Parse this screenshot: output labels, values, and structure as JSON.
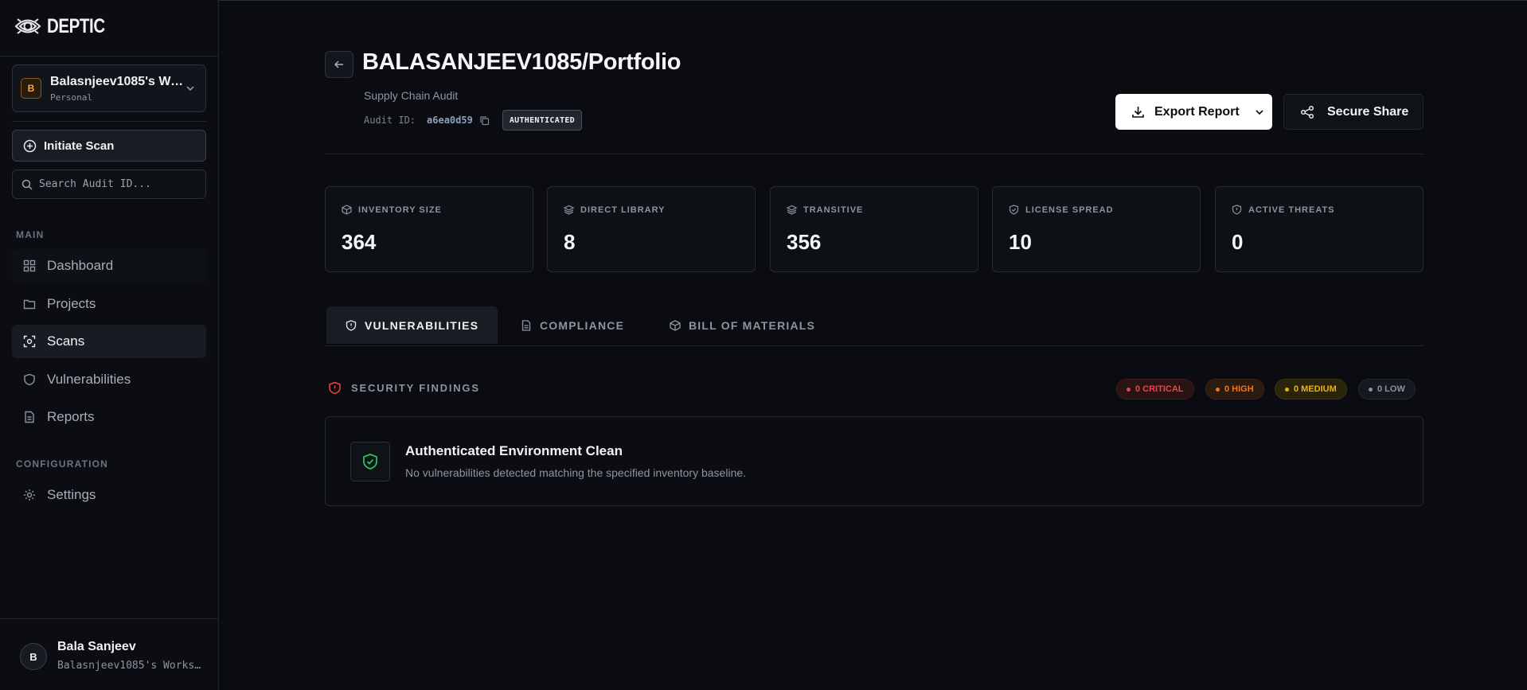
{
  "brand": {
    "name": "DEPTIC"
  },
  "workspace": {
    "initial": "B",
    "name": "Balasnjeev1085's Workspace",
    "type": "Personal"
  },
  "actions": {
    "initiate_scan": "Initiate Scan",
    "search_placeholder": "Search Audit ID..."
  },
  "sidebar": {
    "main_label": "MAIN",
    "items": [
      {
        "label": "Dashboard",
        "icon": "grid-icon"
      },
      {
        "label": "Projects",
        "icon": "folder-icon"
      },
      {
        "label": "Scans",
        "icon": "scan-icon",
        "active": true
      },
      {
        "label": "Vulnerabilities",
        "icon": "shield-icon"
      },
      {
        "label": "Reports",
        "icon": "document-icon"
      }
    ],
    "config_label": "CONFIGURATION",
    "config_items": [
      {
        "label": "Settings",
        "icon": "gear-icon"
      }
    ]
  },
  "user": {
    "initial": "B",
    "name": "Bala Sanjeev",
    "workspace": "Balasnjeev1085's Workspace"
  },
  "header": {
    "title": "BALASANJEEV1085/Portfolio",
    "subtitle": "Supply Chain Audit",
    "audit_label": "Audit ID:",
    "audit_id": "a6ea0d59",
    "badge": "AUTHENTICATED",
    "export_label": "Export Report",
    "share_label": "Secure Share"
  },
  "stats": [
    {
      "label": "INVENTORY SIZE",
      "value": "364"
    },
    {
      "label": "DIRECT LIBRARY",
      "value": "8"
    },
    {
      "label": "TRANSITIVE",
      "value": "356"
    },
    {
      "label": "LICENSE SPREAD",
      "value": "10"
    },
    {
      "label": "ACTIVE THREATS",
      "value": "0"
    }
  ],
  "tabs": [
    {
      "label": "VULNERABILITIES",
      "active": true
    },
    {
      "label": "COMPLIANCE"
    },
    {
      "label": "BILL OF MATERIALS"
    }
  ],
  "findings": {
    "title": "SECURITY FINDINGS",
    "severity": [
      {
        "label": "0 CRITICAL",
        "color": "#ef4444"
      },
      {
        "label": "0 HIGH",
        "color": "#f97316"
      },
      {
        "label": "0 MEDIUM",
        "color": "#eab308"
      },
      {
        "label": "0 LOW",
        "color": "#8d93a0"
      }
    ],
    "clean_title": "Authenticated Environment Clean",
    "clean_message": "No vulnerabilities detected matching the specified inventory baseline."
  },
  "colors": {
    "background": "#0a0c11",
    "accent_green": "#22c55e",
    "accent_orange": "#f5a94a"
  }
}
